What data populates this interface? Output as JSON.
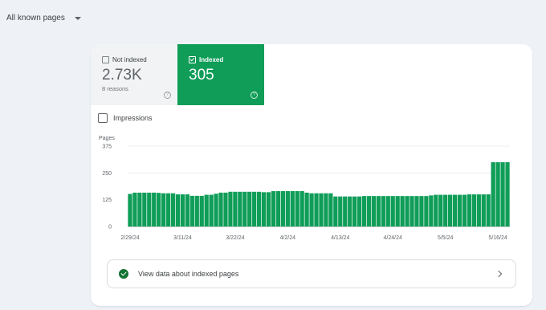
{
  "filter": {
    "label": "All known pages"
  },
  "tiles": {
    "not_indexed": {
      "label": "Not indexed",
      "value": "2.73K",
      "sub": "8 reasons",
      "checked": false
    },
    "indexed": {
      "label": "Indexed",
      "value": "305",
      "checked": true
    }
  },
  "impressions": {
    "label": "Impressions",
    "checked": false
  },
  "cta": {
    "label": "View data about indexed pages"
  },
  "colors": {
    "indexed": "#0f9d58",
    "accent_dark": "#137333"
  },
  "chart_data": {
    "type": "bar",
    "ylabel": "Pages",
    "ylim": [
      0,
      375
    ],
    "yticks": [
      0,
      125,
      250,
      375
    ],
    "xtick_labels": [
      "2/29/24",
      "3/11/24",
      "3/22/24",
      "4/2/24",
      "4/13/24",
      "4/24/24",
      "5/5/24",
      "5/16/24"
    ],
    "xtick_index": [
      0,
      11,
      22,
      33,
      44,
      55,
      66,
      77
    ],
    "values": [
      152,
      158,
      158,
      158,
      158,
      158,
      157,
      155,
      155,
      155,
      150,
      150,
      150,
      143,
      143,
      143,
      148,
      148,
      153,
      158,
      158,
      162,
      162,
      162,
      162,
      162,
      162,
      162,
      160,
      160,
      165,
      165,
      165,
      165,
      165,
      165,
      165,
      158,
      155,
      155,
      155,
      155,
      155,
      140,
      140,
      140,
      140,
      140,
      140,
      142,
      142,
      142,
      142,
      142,
      142,
      142,
      142,
      142,
      142,
      142,
      142,
      142,
      142,
      145,
      148,
      148,
      148,
      148,
      148,
      148,
      148,
      150,
      150,
      150,
      150,
      150,
      300,
      300,
      300,
      300
    ],
    "series": [
      {
        "name": "Indexed",
        "color": "#0f9d58"
      }
    ]
  }
}
